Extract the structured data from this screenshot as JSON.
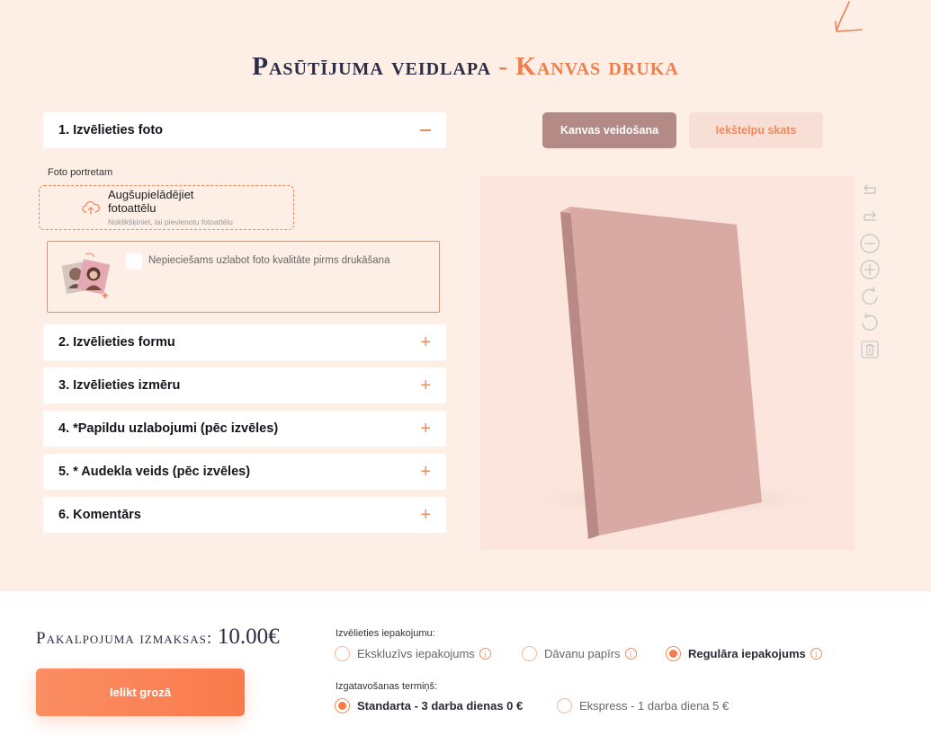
{
  "header": {
    "title_main": "Pasūtījuma veidlapa",
    "title_sep": " - ",
    "title_accent": "Kanvas druka"
  },
  "accordion": [
    {
      "label": "1. Izvēlieties foto",
      "state": "open"
    },
    {
      "label": "2. Izvēlieties formu",
      "state": "closed"
    },
    {
      "label": "3. Izvēlieties izmēru",
      "state": "closed"
    },
    {
      "label": "4. *Papildu uzlabojumi (pēc izvēles)",
      "state": "closed"
    },
    {
      "label": "5. * Audekla veids (pēc izvēles)",
      "state": "closed"
    },
    {
      "label": "6. Komentārs",
      "state": "closed"
    }
  ],
  "photo_section": {
    "label": "Foto portretam",
    "upload_title": "Augšupielādējiet fotoattēlu",
    "upload_sub": "Noklikšķiniet, lai pievienotu fotoattēlu",
    "quality_text": "Nepieciešams uzlabot foto kvalitāte pirms drukāšana",
    "quality_checked": false
  },
  "view_tabs": {
    "active": "Kanvas veidošana",
    "inactive": "Iekštelpu skats"
  },
  "tools": [
    "undo-icon",
    "redo-icon",
    "zoom-out-icon",
    "zoom-in-icon",
    "rotate-right-icon",
    "rotate-left-icon",
    "trash-icon"
  ],
  "footer": {
    "price_label": "Pakalpojuma izmaksas:",
    "price_value": "10.00€",
    "cart_button": "Ielikt grozā",
    "packaging_label": "Izvēlieties iepakojumu:",
    "packaging_options": [
      {
        "label": "Ekskluzīvs iepakojums",
        "selected": false
      },
      {
        "label": "Dāvanu papīrs",
        "selected": false
      },
      {
        "label": "Regulāra iepakojums",
        "selected": true
      }
    ],
    "term_label": "Izgatavošanas termiņš:",
    "term_options": [
      {
        "label": "Standarta - 3 darba dienas 0 €",
        "selected": true
      },
      {
        "label": "Ekspress - 1 darba diena 5 €",
        "selected": false
      }
    ],
    "info_glyph": "i"
  },
  "colors": {
    "background": "#fdefe6",
    "accent": "#f57b49",
    "canvas": "#d9aaa3",
    "tab_active": "#b38a86"
  }
}
